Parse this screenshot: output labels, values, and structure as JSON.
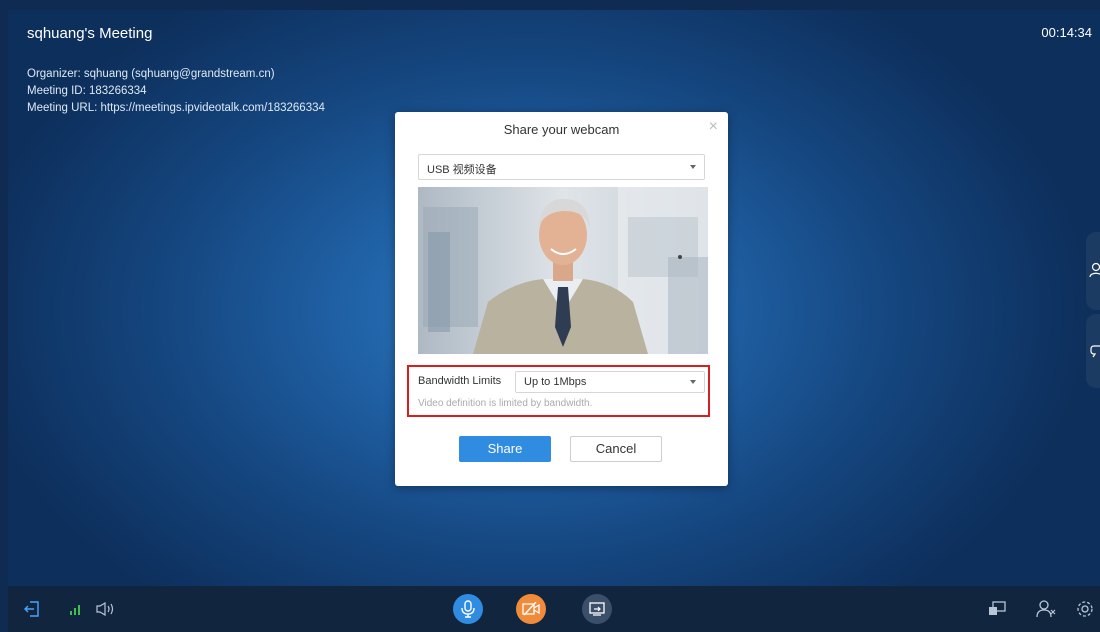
{
  "meeting": {
    "title": "sqhuang's Meeting",
    "timer": "00:14:34",
    "organizer": "Organizer: sqhuang (sqhuang@grandstream.cn)",
    "meeting_id": "Meeting ID: 183266334",
    "meeting_url": "Meeting URL: https://meetings.ipvideotalk.com/183266334"
  },
  "dialog": {
    "title": "Share your webcam",
    "close_glyph": "×",
    "camera_select": "USB 视频设备",
    "bandwidth_label": "Bandwidth Limits",
    "bandwidth_select": "Up to 1Mbps",
    "bandwidth_hint": "Video definition is limited by bandwidth.",
    "share_label": "Share",
    "cancel_label": "Cancel"
  },
  "toolbar": {
    "icons": [
      "exit-icon",
      "signal-icon",
      "speaker-icon",
      "microphone-icon",
      "camera-off-icon",
      "screen-share-icon",
      "layout-icon",
      "participants-icon",
      "settings-icon"
    ]
  },
  "colors": {
    "accent": "#2f8ce0",
    "camera_orange": "#f08b3c",
    "highlight_red": "#d81e1e",
    "toolbar_bg": "#11253f"
  }
}
